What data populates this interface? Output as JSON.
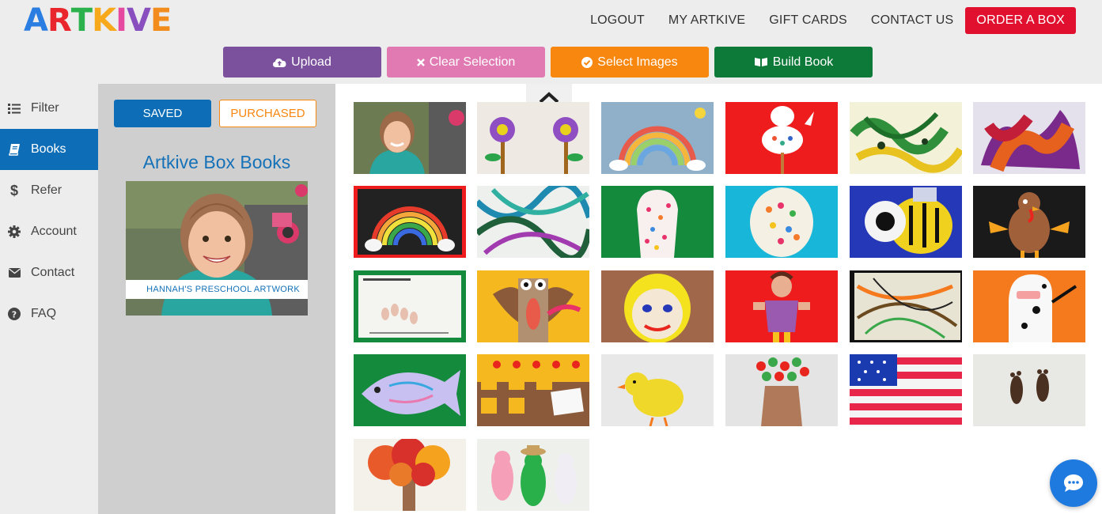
{
  "brand": {
    "letters": [
      "A",
      "R",
      "T",
      "K",
      "I",
      "V",
      "E"
    ],
    "colors": [
      "#2a7de1",
      "#e8262c",
      "#2bb24c",
      "#f7a81b",
      "#e54aa0",
      "#8a4fbf",
      "#f28c1c"
    ]
  },
  "nav": {
    "logout": "LOGOUT",
    "my_artkive": "MY ARTKIVE",
    "gift_cards": "GIFT CARDS",
    "contact_us": "CONTACT US",
    "order_box": "ORDER A BOX"
  },
  "actions": {
    "upload": "Upload",
    "clear": "Clear Selection",
    "select": "Select Images",
    "build": "Build Book"
  },
  "sidebar": {
    "items": [
      {
        "label": "Filter",
        "icon": "list-icon"
      },
      {
        "label": "Books",
        "icon": "book-icon"
      },
      {
        "label": "Refer",
        "icon": "dollar-icon"
      },
      {
        "label": "Account",
        "icon": "gear-icon"
      },
      {
        "label": "Contact",
        "icon": "envelope-icon"
      },
      {
        "label": "FAQ",
        "icon": "question-icon"
      }
    ],
    "active": "Books"
  },
  "books": {
    "tab_saved": "SAVED",
    "tab_purchased": "PURCHASED",
    "title": "Artkive Box Books",
    "card_caption": "HANNAH'S PRESCHOOL ARTWORK"
  },
  "colors": {
    "primary_blue": "#0d6eb7",
    "order_red": "#e0102e",
    "upload_purple": "#7b519e",
    "clear_pink": "#e17ab3",
    "select_orange": "#f7870f",
    "build_green": "#0d7a3a"
  }
}
